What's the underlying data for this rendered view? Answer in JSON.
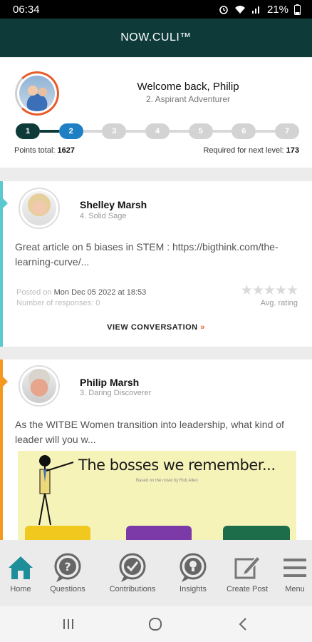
{
  "status_bar": {
    "time": "06:34",
    "battery": "21%"
  },
  "app": {
    "title": "NOW.CULI™"
  },
  "profile": {
    "welcome": "Welcome back, Philip",
    "level_name": "2. Aspirant Adventurer",
    "levels": [
      "1",
      "2",
      "3",
      "4",
      "5",
      "6",
      "7"
    ],
    "current_level": 2,
    "points_label": "Points total:",
    "points_value": "1627",
    "required_label": "Required for next level:",
    "required_value": "173"
  },
  "posts": [
    {
      "author": "Shelley Marsh",
      "rank": "4. Solid Sage",
      "text": "Great article on 5 biases in STEM : https://bigthink.com/the-learning-curve/...",
      "posted_label": "Posted on",
      "posted_value": "Mon Dec 05 2022 at 18:53",
      "responses_label": "Number of responses:",
      "responses_value": "0",
      "stars": "★★★★★",
      "rating": 0,
      "avg_label": "Avg. rating",
      "view_label": "VIEW CONVERSATION",
      "chevron": "»",
      "accent": "#5cc8cf"
    },
    {
      "author": "Philip Marsh",
      "rank": "3. Daring Discoverer",
      "text": "As the WITBE Women transition into leadership, what kind of leader will you w...",
      "image_title": "The bosses we remember...",
      "image_subtitle": "Based on the novel by Rob Allen",
      "accent": "#f39a1e"
    }
  ],
  "bottom_nav": [
    {
      "label": "Home",
      "icon": "home-icon"
    },
    {
      "label": "Questions",
      "icon": "question-bubble-icon"
    },
    {
      "label": "Contributions",
      "icon": "check-bubble-icon"
    },
    {
      "label": "Insights",
      "icon": "lightbulb-bubble-icon"
    },
    {
      "label": "Create Post",
      "icon": "edit-icon"
    },
    {
      "label": "Menu",
      "icon": "menu-icon"
    }
  ],
  "colors": {
    "header": "#0e3b3a",
    "active_level": "#1f7fc4",
    "done_level": "#0e3b3a",
    "accent": "#e8612a",
    "home_active": "#1e8e9a"
  }
}
